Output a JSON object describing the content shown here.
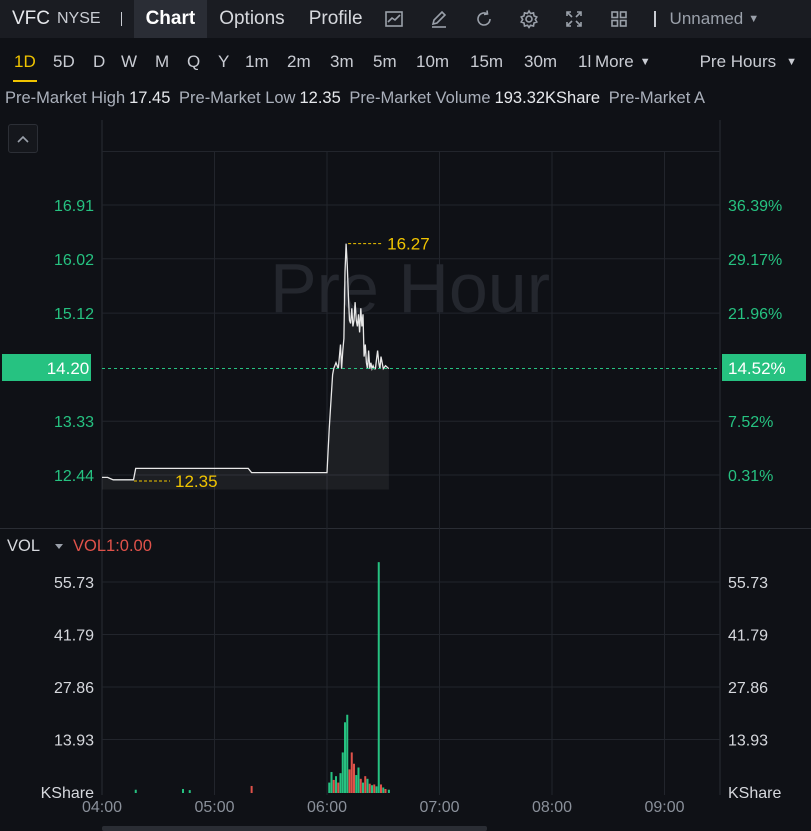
{
  "header": {
    "ticker": "VFC",
    "exchange": "NYSE",
    "tabs": [
      {
        "label": "Chart",
        "active": true
      },
      {
        "label": "Options",
        "active": false
      },
      {
        "label": "Profile",
        "active": false
      }
    ],
    "tools": [
      "indicator-icon",
      "draw-icon",
      "refresh-icon",
      "settings-icon",
      "fullscreen-icon",
      "layout-icon"
    ],
    "layout_name": "Unnamed"
  },
  "periods": {
    "items": [
      "1D",
      "5D",
      "D",
      "W",
      "M",
      "Q",
      "Y",
      "1m",
      "2m",
      "3m",
      "5m",
      "10m",
      "15m",
      "30m",
      "1l"
    ],
    "active": "1D",
    "more_label": "More",
    "session_label": "Pre Hours"
  },
  "stats": {
    "high_label": "Pre-Market High",
    "high_value": "17.45",
    "low_label": "Pre-Market Low",
    "low_value": "12.35",
    "volume_label": "Pre-Market Volume",
    "volume_value": "193.32KShare",
    "extra_label": "Pre-Market A"
  },
  "colors": {
    "up": "#26c281",
    "down": "#e0524a",
    "highlight": "#f0c400",
    "axis_text": "#26c281",
    "grid": "#22252c"
  },
  "chart_data": [
    {
      "type": "line",
      "watermark": "Pre Hour",
      "x_ticks": [
        "04:00",
        "05:00",
        "06:00",
        "07:00",
        "08:00",
        "09:00"
      ],
      "x_range_hours": [
        4.0,
        9.5
      ],
      "y_left_ticks": [
        "16.91",
        "16.02",
        "15.12",
        "13.33",
        "12.44"
      ],
      "y_right_ticks": [
        "36.39%",
        "29.17%",
        "21.96%",
        "7.52%",
        "0.31%"
      ],
      "ylim": [
        11.85,
        17.65
      ],
      "current_price": {
        "value": 14.2,
        "label": "14.20",
        "pct_label": "14.52%"
      },
      "high_marker": {
        "value": 16.27,
        "label": "16.27",
        "time": 6.17
      },
      "low_marker": {
        "value": 12.35,
        "label": 12.35,
        "time": 4.28
      },
      "series": [
        {
          "x": [
            4.0,
            4.05,
            4.1,
            4.15,
            4.2,
            4.25,
            4.28,
            4.3,
            4.4,
            4.5,
            4.6,
            4.7,
            4.8,
            4.9,
            5.0,
            5.1,
            5.2,
            5.3,
            5.33,
            5.4,
            5.5,
            5.6,
            5.7,
            5.8,
            5.9,
            6.0,
            6.02,
            6.05,
            6.06,
            6.08,
            6.1,
            6.11,
            6.12,
            6.13,
            6.14,
            6.15,
            6.16,
            6.17,
            6.18,
            6.19,
            6.2,
            6.21,
            6.22,
            6.23,
            6.24,
            6.25,
            6.26,
            6.27,
            6.28,
            6.29,
            6.3,
            6.31,
            6.32,
            6.33,
            6.34,
            6.35,
            6.36,
            6.37,
            6.38,
            6.39,
            6.4,
            6.41,
            6.42,
            6.43,
            6.44,
            6.45,
            6.46,
            6.47,
            6.48,
            6.5,
            6.52,
            6.55
          ],
          "y": [
            12.4,
            12.4,
            12.36,
            12.36,
            12.36,
            12.36,
            12.36,
            12.55,
            12.55,
            12.55,
            12.55,
            12.55,
            12.55,
            12.55,
            12.55,
            12.55,
            12.55,
            12.55,
            12.48,
            12.48,
            12.48,
            12.48,
            12.48,
            12.48,
            12.48,
            12.48,
            13.2,
            14.1,
            14.2,
            14.3,
            14.2,
            14.4,
            14.6,
            14.2,
            14.5,
            14.7,
            15.8,
            16.27,
            15.9,
            15.4,
            15.0,
            14.95,
            15.2,
            14.9,
            15.0,
            15.3,
            15.0,
            14.9,
            15.1,
            14.8,
            15.2,
            14.9,
            15.1,
            14.4,
            14.6,
            14.3,
            14.2,
            14.5,
            14.2,
            14.3,
            14.2,
            14.25,
            14.2,
            14.2,
            14.35,
            14.5,
            14.3,
            14.2,
            14.4,
            14.2,
            14.25,
            14.2
          ]
        }
      ]
    },
    {
      "type": "bar",
      "title": "VOL",
      "indicator_label": "VOL1:0.00",
      "unit": "KShare",
      "y_ticks": [
        "55.73",
        "41.79",
        "27.86",
        "13.93"
      ],
      "ylim": [
        0,
        64
      ],
      "x_range_hours": [
        4.0,
        9.5
      ],
      "bars": [
        {
          "t": 4.3,
          "v": 0.6,
          "up": true
        },
        {
          "t": 4.72,
          "v": 0.8,
          "up": true
        },
        {
          "t": 4.78,
          "v": 0.5,
          "up": true
        },
        {
          "t": 5.33,
          "v": 1.6,
          "up": false
        },
        {
          "t": 6.02,
          "v": 2.5,
          "up": true
        },
        {
          "t": 6.04,
          "v": 5.3,
          "up": true
        },
        {
          "t": 6.06,
          "v": 3.2,
          "up": false
        },
        {
          "t": 6.08,
          "v": 4.2,
          "up": true
        },
        {
          "t": 6.1,
          "v": 2.5,
          "up": false
        },
        {
          "t": 6.12,
          "v": 5.0,
          "up": true
        },
        {
          "t": 6.14,
          "v": 10.5,
          "up": true
        },
        {
          "t": 6.16,
          "v": 18.5,
          "up": true
        },
        {
          "t": 6.18,
          "v": 20.5,
          "up": true
        },
        {
          "t": 6.2,
          "v": 6.0,
          "up": false
        },
        {
          "t": 6.22,
          "v": 10.5,
          "up": false
        },
        {
          "t": 6.24,
          "v": 7.5,
          "up": false
        },
        {
          "t": 6.26,
          "v": 4.5,
          "up": true
        },
        {
          "t": 6.28,
          "v": 6.5,
          "up": true
        },
        {
          "t": 6.3,
          "v": 3.5,
          "up": false
        },
        {
          "t": 6.32,
          "v": 2.5,
          "up": true
        },
        {
          "t": 6.34,
          "v": 4.2,
          "up": false
        },
        {
          "t": 6.36,
          "v": 3.5,
          "up": true
        },
        {
          "t": 6.38,
          "v": 2.2,
          "up": false
        },
        {
          "t": 6.4,
          "v": 1.8,
          "up": true
        },
        {
          "t": 6.42,
          "v": 2.0,
          "up": false
        },
        {
          "t": 6.44,
          "v": 1.5,
          "up": true
        },
        {
          "t": 6.46,
          "v": 61.0,
          "up": true
        },
        {
          "t": 6.48,
          "v": 2.0,
          "up": false
        },
        {
          "t": 6.5,
          "v": 1.2,
          "up": true
        },
        {
          "t": 6.52,
          "v": 0.8,
          "up": false
        },
        {
          "t": 6.55,
          "v": 0.6,
          "up": true
        }
      ]
    }
  ]
}
